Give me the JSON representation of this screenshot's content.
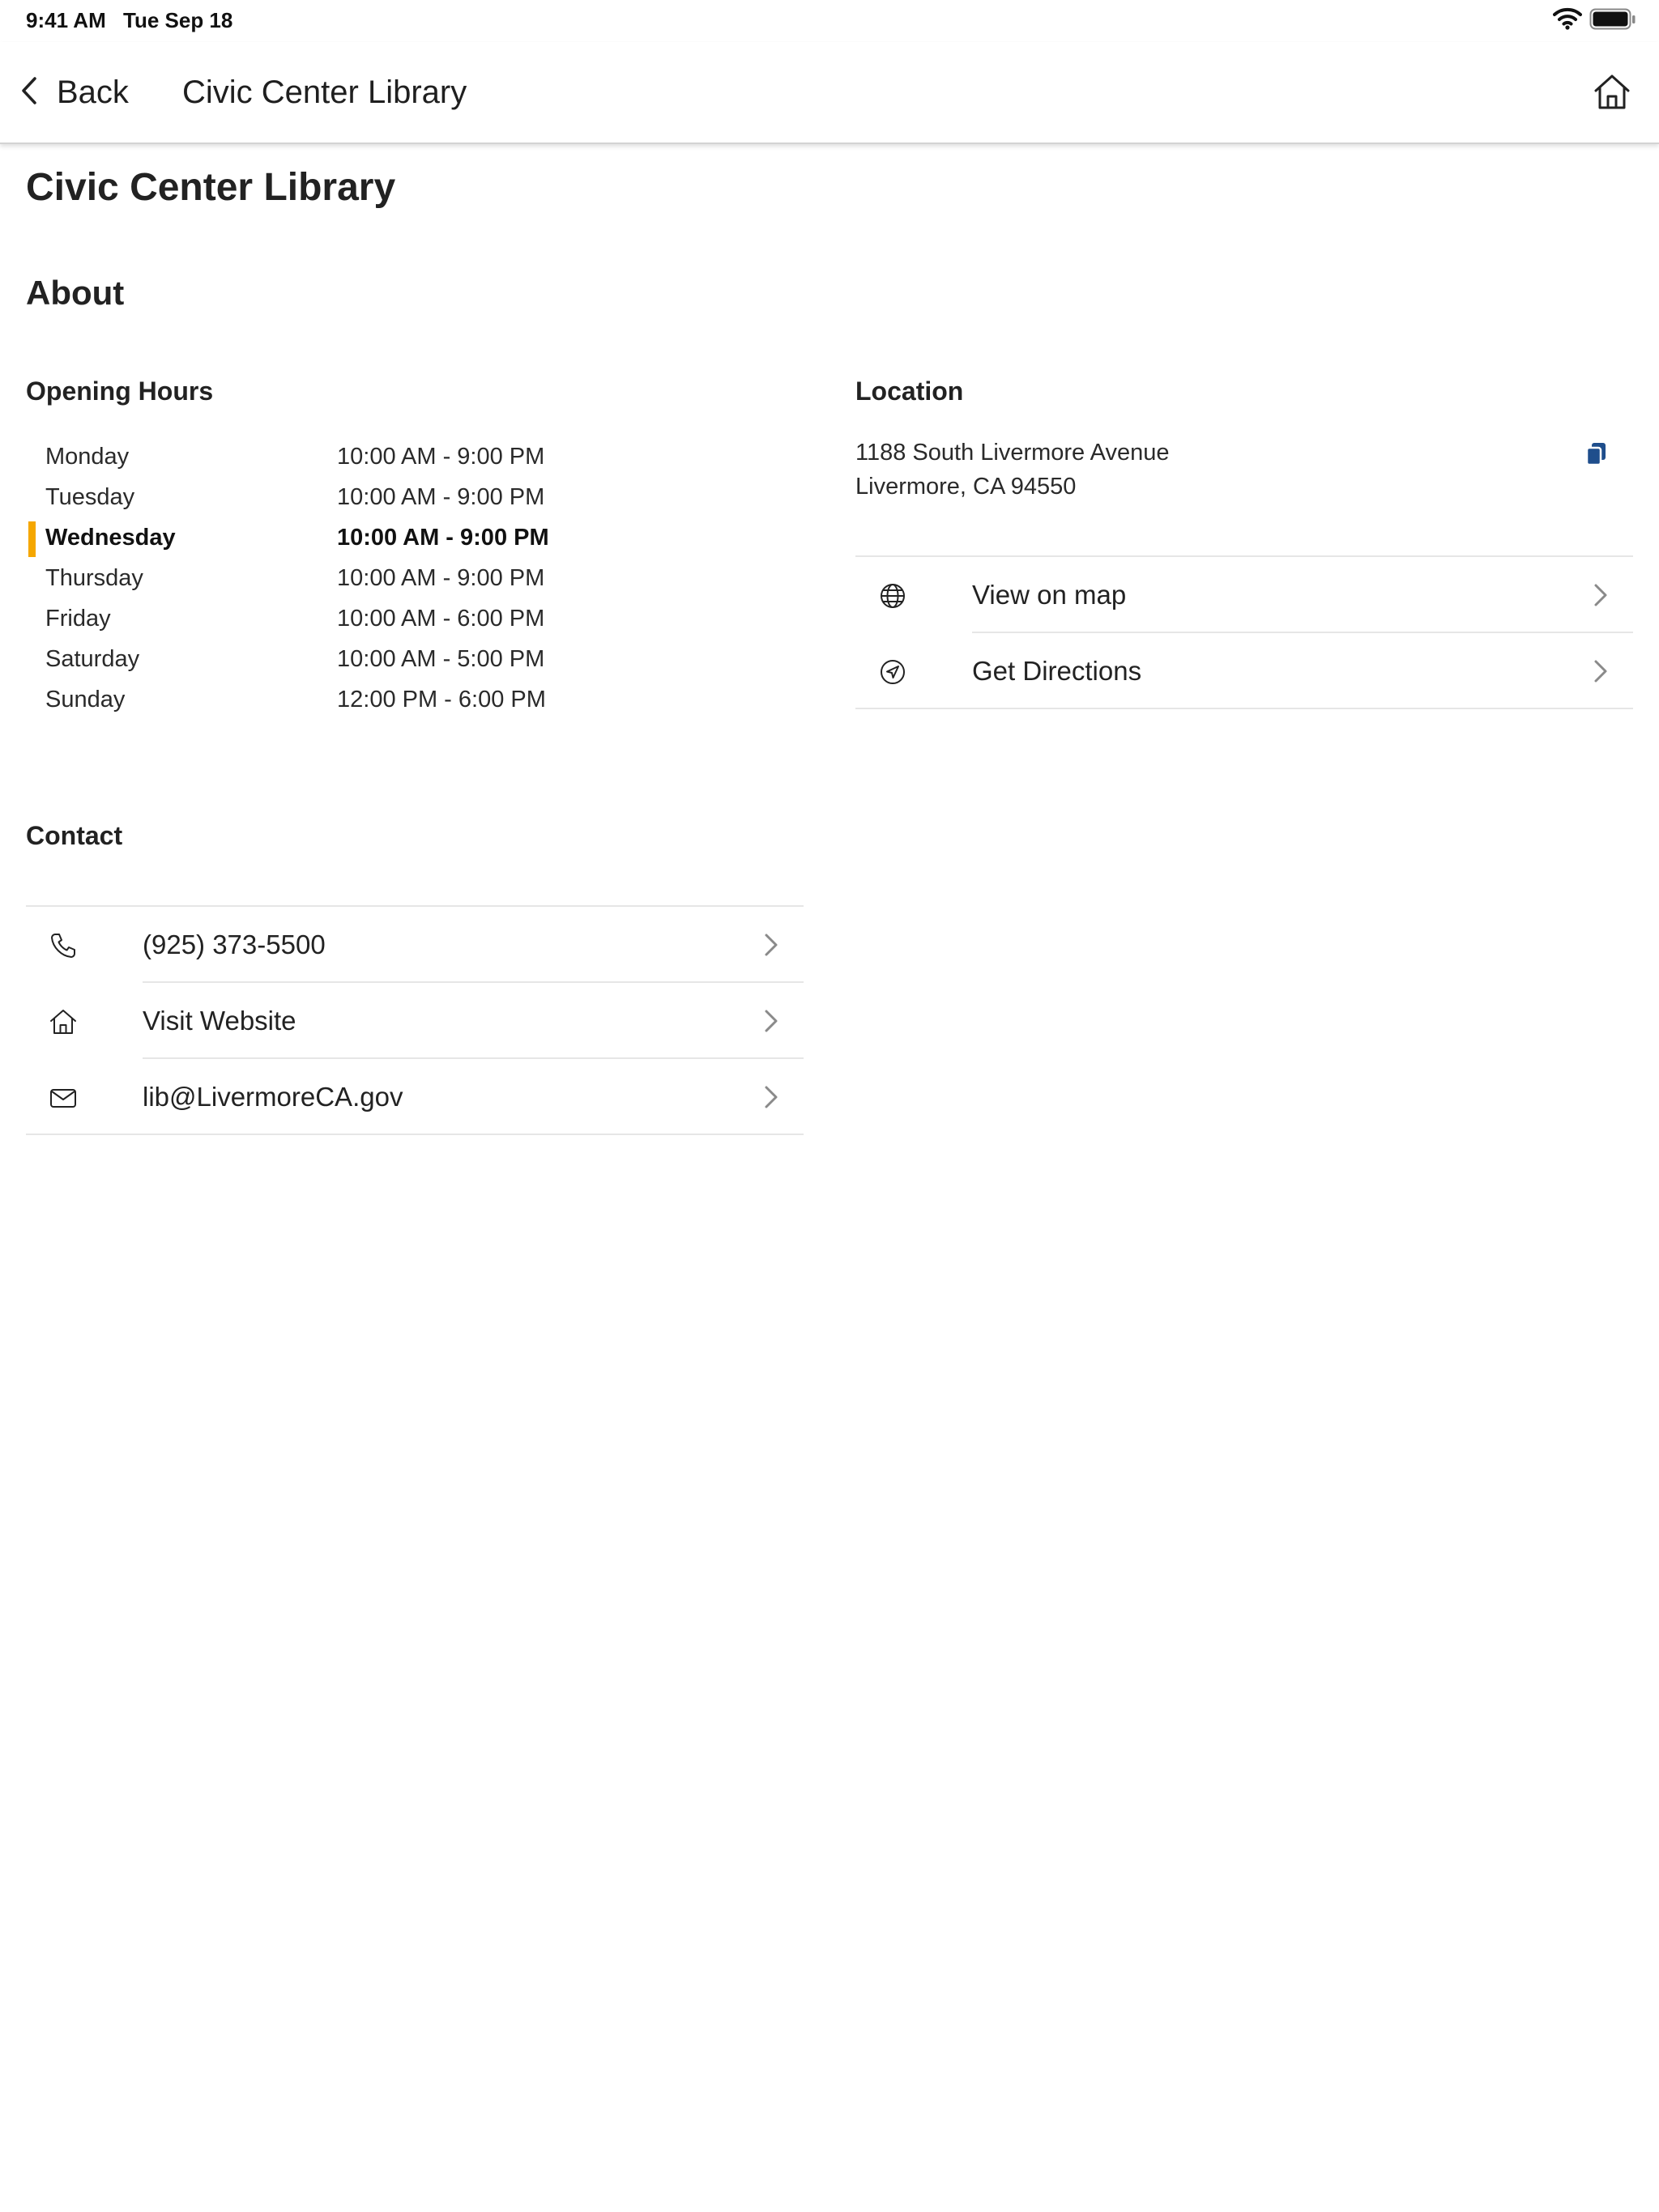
{
  "status_bar": {
    "time": "9:41 AM",
    "date": "Tue Sep 18",
    "wifi_icon": "wifi-icon",
    "battery_icon": "battery-icon"
  },
  "nav": {
    "back_label": "Back",
    "title": "Civic Center Library",
    "home_icon": "home-icon"
  },
  "page": {
    "title": "Civic Center Library",
    "about_heading": "About"
  },
  "hours": {
    "heading": "Opening Hours",
    "today_color": "#f5a700",
    "rows": [
      {
        "day": "Monday",
        "time": "10:00 AM - 9:00 PM"
      },
      {
        "day": "Tuesday",
        "time": "10:00 AM - 9:00 PM"
      },
      {
        "day": "Wednesday",
        "time": "10:00 AM - 9:00 PM",
        "today": true
      },
      {
        "day": "Thursday",
        "time": "10:00 AM - 9:00 PM"
      },
      {
        "day": "Friday",
        "time": "10:00 AM - 6:00 PM"
      },
      {
        "day": "Saturday",
        "time": "10:00 AM - 5:00 PM"
      },
      {
        "day": "Sunday",
        "time": "12:00 PM - 6:00 PM"
      }
    ]
  },
  "location": {
    "heading": "Location",
    "address_line1": "1188 South Livermore Avenue",
    "address_line2": "Livermore, CA 94550",
    "copy_icon": "copy-icon",
    "copy_icon_color": "#1f4e8c",
    "actions": [
      {
        "label": "View on map",
        "icon": "globe-icon"
      },
      {
        "label": "Get Directions",
        "icon": "navigation-arrow-icon"
      }
    ]
  },
  "contact": {
    "heading": "Contact",
    "items": [
      {
        "label": "(925) 373-5500",
        "icon": "phone-icon"
      },
      {
        "label": "Visit Website",
        "icon": "home-icon"
      },
      {
        "label": "lib@LivermoreCA.gov",
        "icon": "mail-icon"
      }
    ]
  }
}
